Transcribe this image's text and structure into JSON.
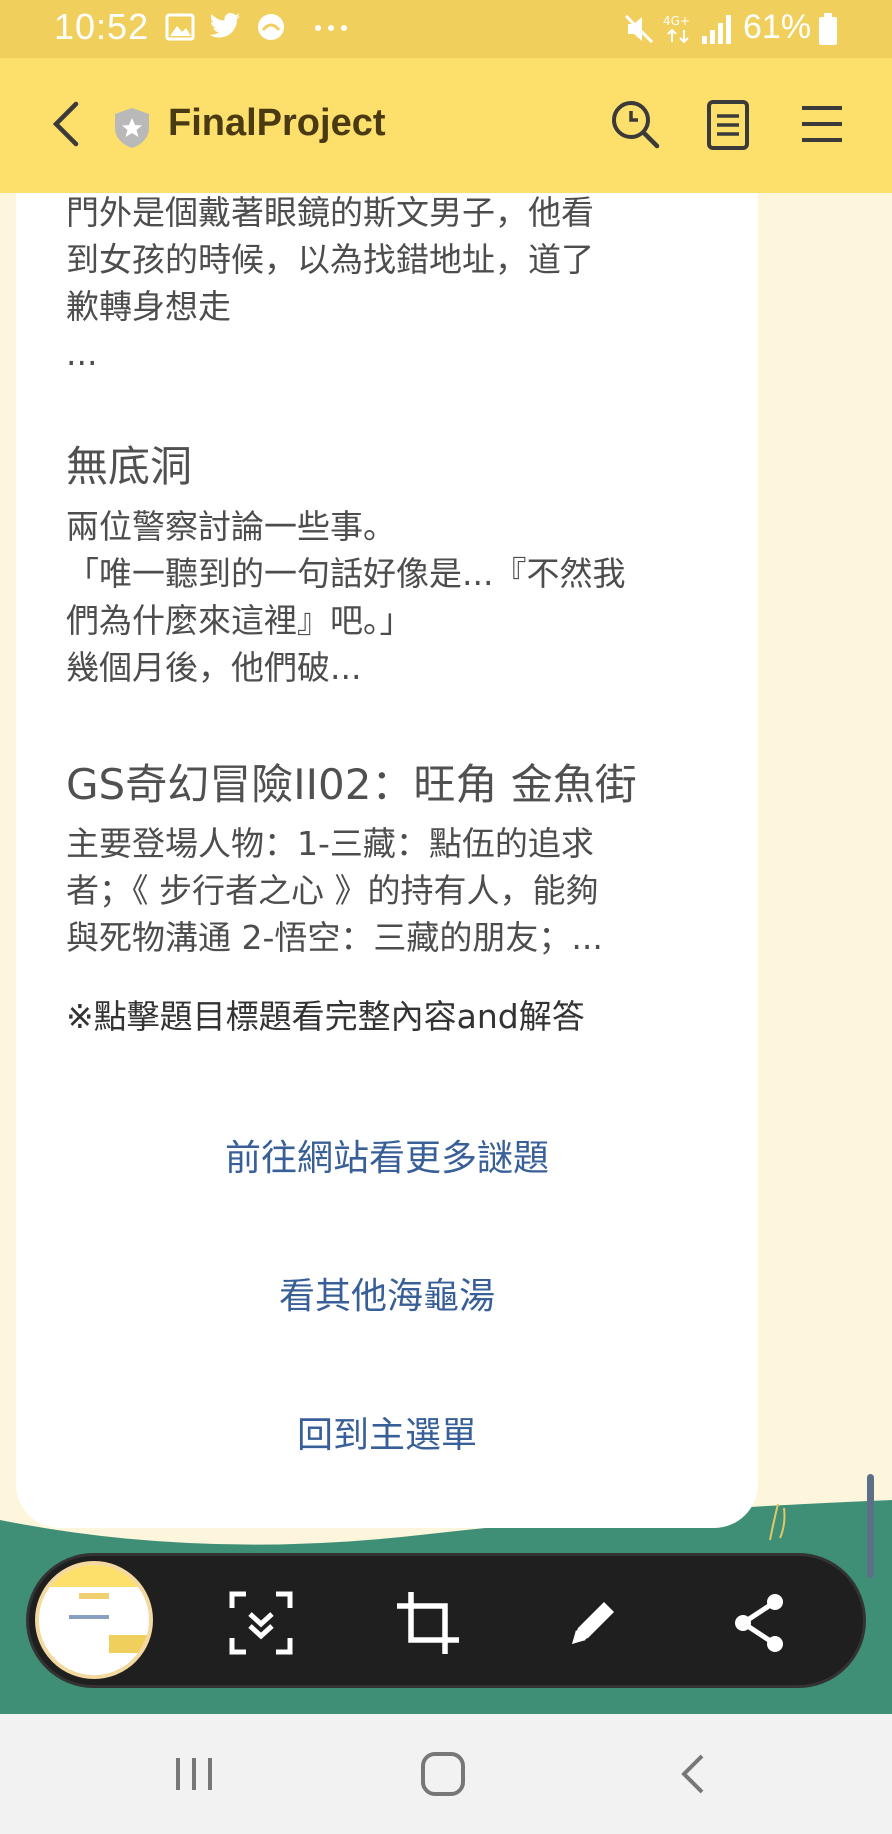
{
  "status_bar": {
    "time": "10:52",
    "battery": "61%"
  },
  "app": {
    "title": "FinalProject"
  },
  "content": {
    "snippet_top": [
      "門外是個戴著眼鏡的斯文男子，他看",
      "到女孩的時候，以為找錯地址，道了",
      "歉轉身想走",
      "..."
    ],
    "story2_title": "無底洞",
    "story2_lines": [
      "兩位警察討論一些事。",
      "「唯一聽到的一句話好像是...『不然我",
      "們為什麼來這裡』吧。」",
      "幾個月後，他們破..."
    ],
    "story3_title": "GS奇幻冒險II02：旺角 金魚街",
    "story3_lines": [
      "主要登場人物：1-三藏：點伍的追求",
      "者；《 步行者之心 》的持有人，能夠",
      "與死物溝通 2-悟空：三藏的朋友；..."
    ],
    "note": "※點擊題目標題看完整內容and解答",
    "links": [
      "前往網站看更多謎題",
      "看其他海龜湯",
      "回到主選單"
    ]
  },
  "icons": {
    "header": [
      "back-icon",
      "shield-icon",
      "search-icon",
      "document-icon",
      "menu-icon"
    ],
    "toolbar": [
      "scroll-capture-icon",
      "crop-icon",
      "pen-icon",
      "share-icon"
    ],
    "nav": [
      "recent-apps-icon",
      "home-icon",
      "back-nav-icon"
    ]
  },
  "colors": {
    "header": "#fddf6b",
    "status_bar": "#f1cf5d",
    "link": "#385f97"
  }
}
